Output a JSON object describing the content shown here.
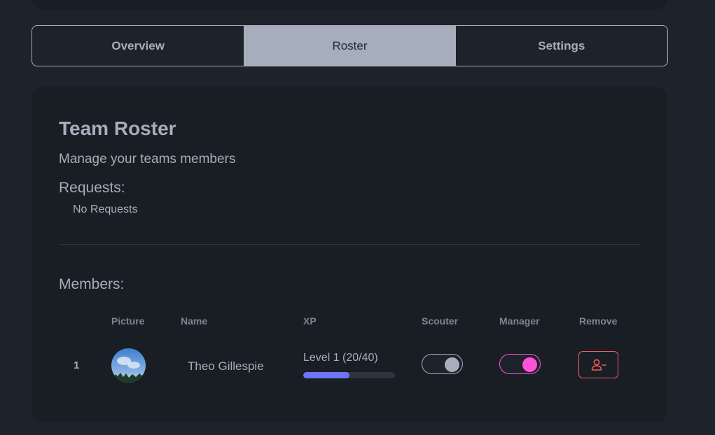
{
  "tabs": [
    {
      "label": "Overview",
      "active": false
    },
    {
      "label": "Roster",
      "active": true
    },
    {
      "label": "Settings",
      "active": false
    }
  ],
  "roster": {
    "title": "Team Roster",
    "subtitle": "Manage your teams members",
    "requests_heading": "Requests:",
    "requests_empty": "No Requests",
    "members_heading": "Members:",
    "columns": [
      "Picture",
      "Name",
      "XP",
      "Scouter",
      "Manager",
      "Remove"
    ],
    "members": [
      {
        "index": "1",
        "avatar_icon": "profile-photo",
        "name": "Theo Gillespie",
        "xp_label": "Level 1 (20/40)",
        "xp_progress": 0.5,
        "scouter": false,
        "manager": true,
        "remove_icon": "user-minus-icon"
      }
    ]
  },
  "colors": {
    "background": "#1e232b",
    "card": "#191e24",
    "text": "#a6adbb",
    "xp_fill": "#6e74f5",
    "manager_toggle": "#ff52d9",
    "remove_red": "#f25c5c"
  }
}
